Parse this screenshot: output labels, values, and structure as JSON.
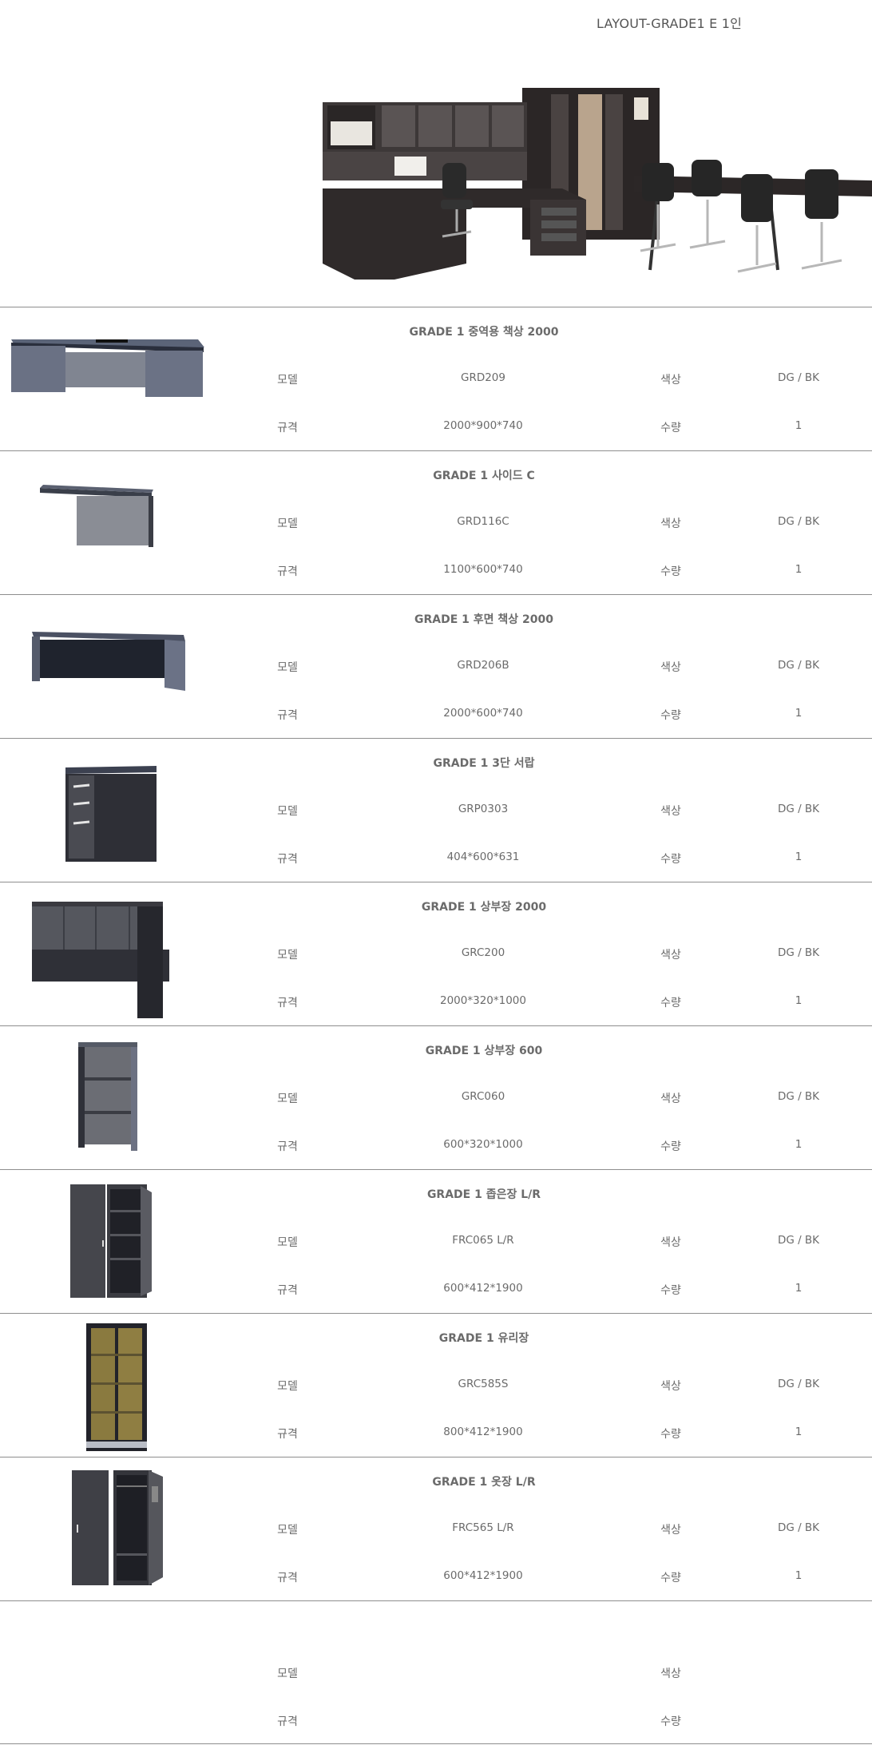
{
  "page": {
    "title": "LAYOUT-GRADE1  E  1인"
  },
  "labels": {
    "model": "모델",
    "spec": "규격",
    "color": "색상",
    "qty": "수량"
  },
  "products": [
    {
      "name": "GRADE 1 중역용 책상 2000",
      "model": "GRD209",
      "color": "DG / BK",
      "spec": "2000*900*740",
      "qty": "1",
      "icon": "executive-desk-icon"
    },
    {
      "name": "GRADE 1 사이드 C",
      "model": "GRD116C",
      "color": "DG / BK",
      "spec": "1100*600*740",
      "qty": "1",
      "icon": "side-return-desk-icon"
    },
    {
      "name": "GRADE 1 후면 책상 2000",
      "model": "GRD206B",
      "color": "DG / BK",
      "spec": "2000*600*740",
      "qty": "1",
      "icon": "credenza-desk-icon"
    },
    {
      "name": "GRADE 1 3단 서랍",
      "model": "GRP0303",
      "color": "DG / BK",
      "spec": "404*600*631",
      "qty": "1",
      "icon": "drawer-pedestal-icon"
    },
    {
      "name": "GRADE 1 상부장 2000",
      "model": "GRC200",
      "color": "DG / BK",
      "spec": "2000*320*1000",
      "qty": "1",
      "icon": "hutch-2000-icon"
    },
    {
      "name": "GRADE 1 상부장 600",
      "model": "GRC060",
      "color": "DG / BK",
      "spec": "600*320*1000",
      "qty": "1",
      "icon": "open-shelf-600-icon"
    },
    {
      "name": "GRADE 1 좁은장 L/R",
      "model": "FRC065 L/R",
      "color": "DG / BK",
      "spec": "600*412*1900",
      "qty": "1",
      "icon": "narrow-cabinet-icon"
    },
    {
      "name": "GRADE 1 유리장",
      "model": "GRC585S",
      "color": "DG / BK",
      "spec": "800*412*1900",
      "qty": "1",
      "icon": "glass-cabinet-icon"
    },
    {
      "name": "GRADE 1 옷장 L/R",
      "model": "FRC565 L/R",
      "color": "DG / BK",
      "spec": "600*412*1900",
      "qty": "1",
      "icon": "wardrobe-icon"
    },
    {
      "name": "",
      "model": "",
      "color": "",
      "spec": "",
      "qty": "",
      "icon": ""
    }
  ]
}
